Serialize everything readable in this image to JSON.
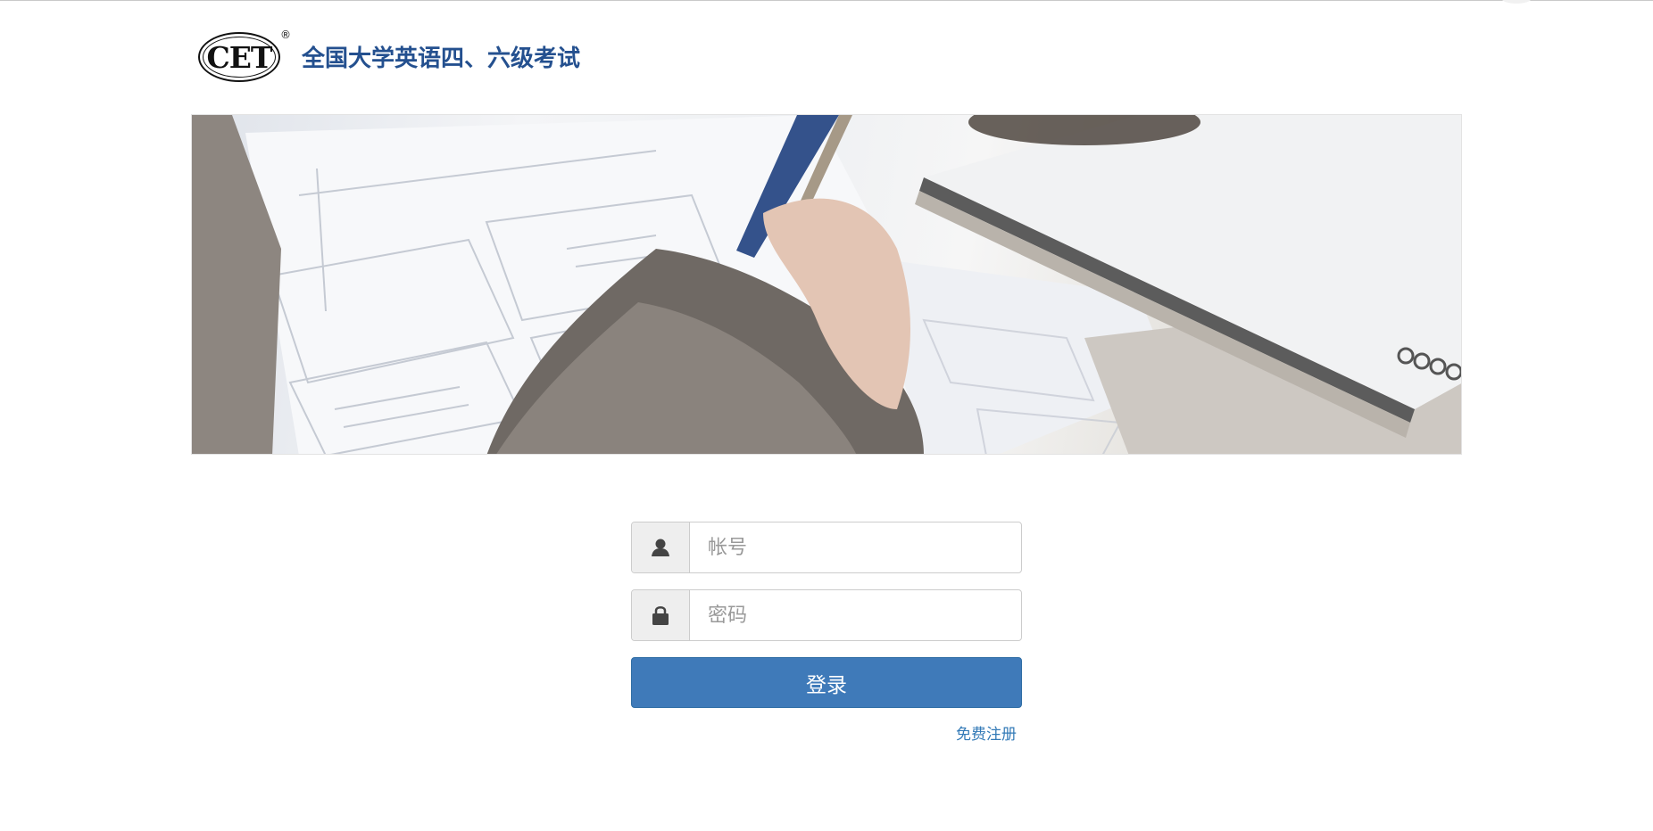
{
  "header": {
    "logo_text": "CET",
    "logo_registered": "®",
    "site_title": "全国大学英语四、六级考试"
  },
  "banner": {
    "image_description_icon": "banner-photo"
  },
  "login_form": {
    "account_placeholder": "帐号",
    "account_icon": "user-icon",
    "password_placeholder": "密码",
    "password_icon": "lock-icon",
    "login_label": "登录",
    "register_label": "免费注册"
  },
  "colors": {
    "title": "#24508f",
    "button": "#3f7ab9",
    "link": "#337ab7"
  }
}
